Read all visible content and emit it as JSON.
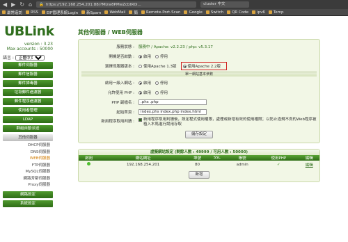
{
  "browser": {
    "url": "https://192.168.254.201:88/?Mlzw8PMwZcbtR0i...",
    "search": "cluster 中文",
    "bookmarks": [
      "最常造訪",
      "RSS",
      "EIP管理系統Login",
      "新Spam",
      "WebMail",
      "簡",
      "Remote-Port-Scan",
      "Google",
      "Switch",
      "QR Code",
      "ipv6",
      "Temp"
    ]
  },
  "sidebar": {
    "logo": "UBLink",
    "version_label": "version : 3.23",
    "max_accounts_label": "Max accounts : 50000",
    "lang_label": "語言 :",
    "lang_value": "正體中文",
    "menu_top": [
      "郵件伺服器",
      "郵件信服器",
      "郵件掃毒器",
      "垃圾郵件過濾器",
      "郵件程序過濾器",
      "使用者管理",
      "LDAP",
      "群組自動派送",
      "其他伺服器"
    ],
    "submenu": [
      "DHCP伺服器",
      "DNS伺服器",
      "WEB伺服器",
      "FTP伺服器",
      "MySQL伺服器",
      "網路芳鄰伺服器",
      "Proxy伺服器"
    ],
    "menu_bottom": [
      "網路設定",
      "系統設定"
    ]
  },
  "main": {
    "title": "其他伺服器 / WEB伺服器",
    "server_version_label": "服務狀態 :",
    "server_version_value": "服務中 / Apache: v2.2.23 / php: v5.3.17",
    "autostart_label": "開機是否啟動 :",
    "enable": "啟用",
    "disable": "停用",
    "apache_label": "選擇伺服器版本 :",
    "apache_opt1": "使用Apache 1.3版",
    "apache_opt2": "使用Apache 2.2版",
    "section_label": "單一網站基本參數",
    "single_site_label": "啟用一級入網站 :",
    "php_label": "允許使用 PHP :",
    "php_ext_label": "PHP 副檔名 :",
    "php_ext_value": ".phs .php",
    "index_label": "起始首頁 :",
    "index_value": "index.phs index.php index.html",
    "new_program_label": "新用程序取用判讀 :",
    "new_program_note": "新用程序取用判讀後，設定程式使用權限，處理或新增有效的使用權限；以防止違規不良的Web程序被植入木馬進行誤用存取",
    "save_button": "儲存設定",
    "vhost_title": "虛擬網站設定 (剩餘人數 : 49999 / 可用人數 : 50000)",
    "vhost_headers": [
      "啟用",
      "網站網址",
      "埠號",
      "SSL",
      "帳號",
      "使用PHP",
      "編輯"
    ],
    "vhost_rows": [
      {
        "url": "192.168.254.201",
        "port": "80",
        "ssl": "",
        "account": "admin",
        "php": "✓",
        "edit": "編輯"
      }
    ],
    "add_button": "新增"
  }
}
